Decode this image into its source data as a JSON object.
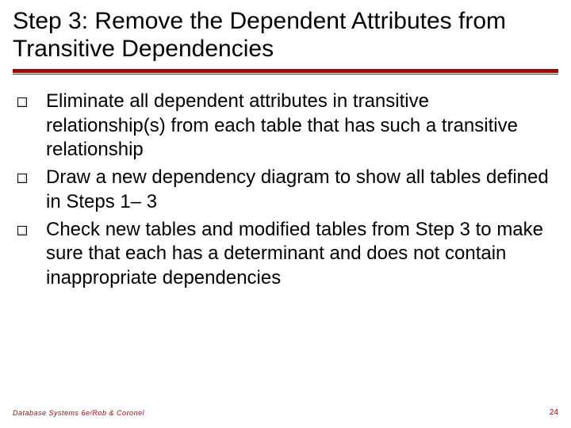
{
  "title": "Step 3: Remove the Dependent Attributes from Transitive Dependencies",
  "bullets": [
    "Eliminate all dependent attributes in transitive relationship(s) from each table that has such a transitive relationship",
    "Draw a new dependency diagram to show all tables defined in Steps 1– 3",
    "Check new tables and modified tables from Step 3 to make sure that each has a determinant and does not contain inappropriate dependencies"
  ],
  "footer": "Database Systems 6e/Rob & Coronel",
  "page_number": "24"
}
